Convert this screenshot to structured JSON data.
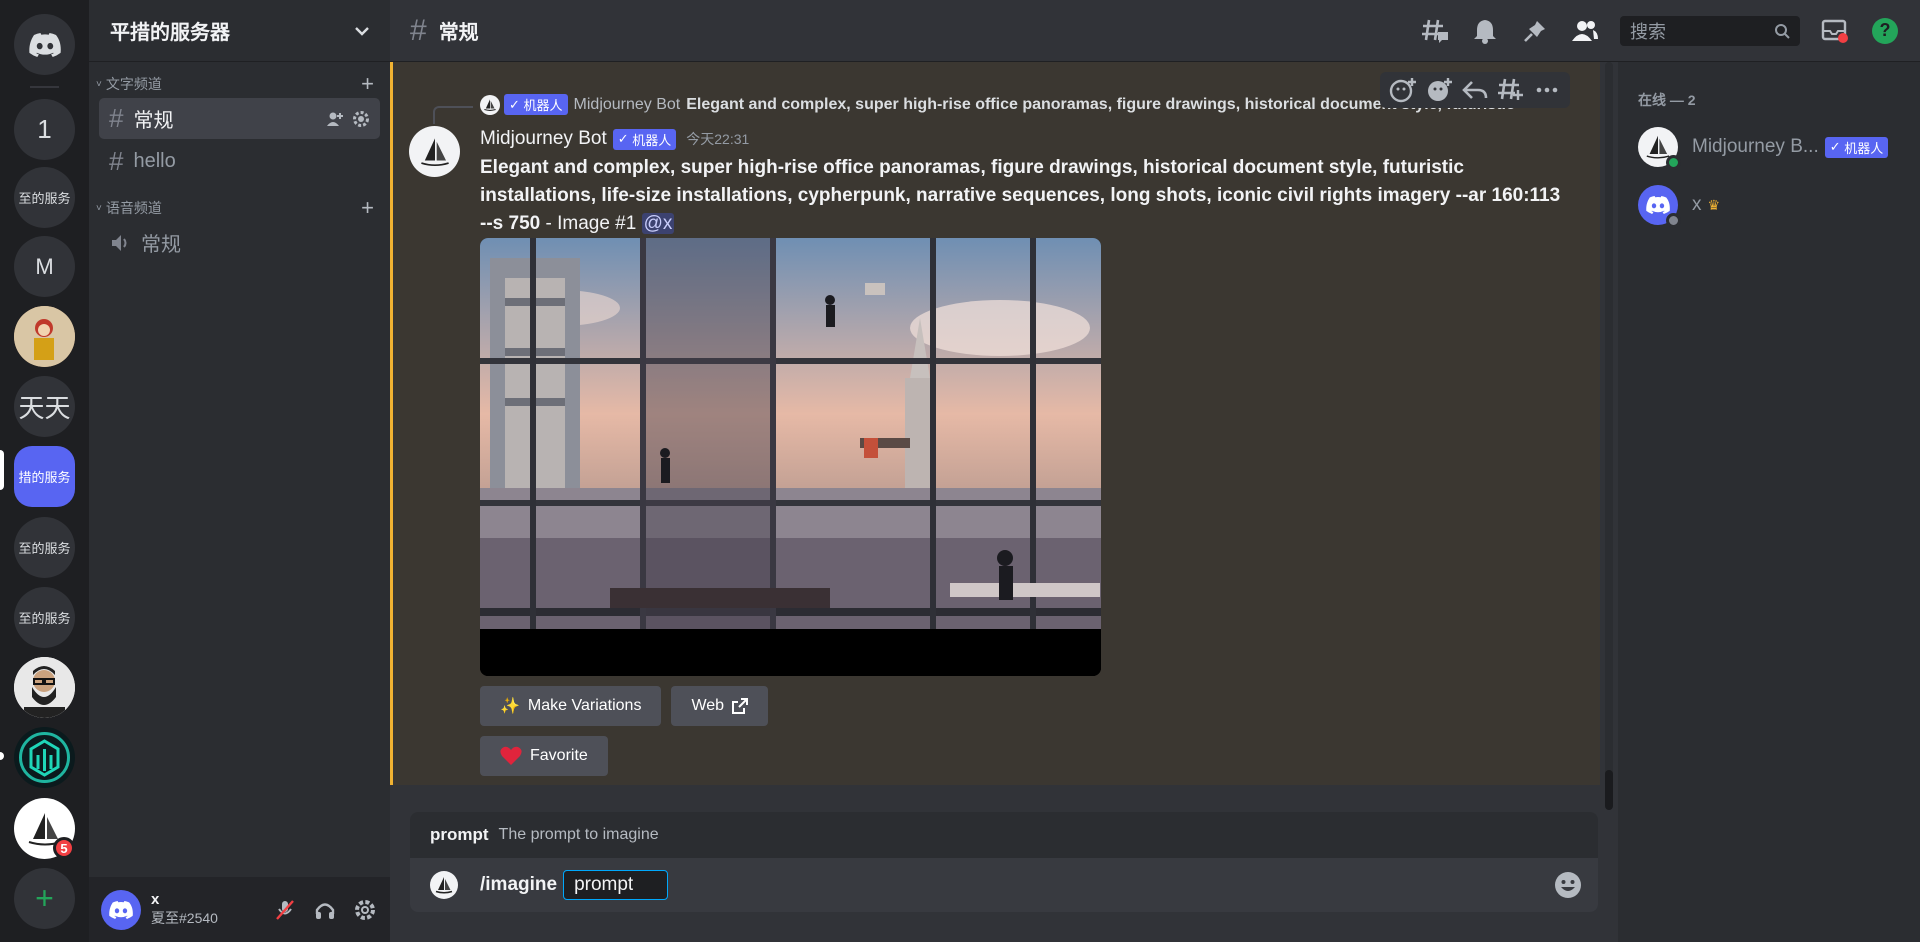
{
  "rail": {
    "servers": [
      {
        "label": "1"
      },
      {
        "label": "至的服务"
      },
      {
        "label": "M"
      },
      {
        "label": ""
      },
      {
        "label": "天天"
      },
      {
        "label": "措的服务"
      },
      {
        "label": "至的服务"
      },
      {
        "label": "至的服务"
      },
      {
        "label": ""
      },
      {
        "label": ""
      },
      {
        "label": "",
        "badge": "5"
      }
    ]
  },
  "server": {
    "name": "平措的服务器"
  },
  "categories": {
    "text": {
      "label": "文字频道"
    },
    "voice": {
      "label": "语音频道"
    }
  },
  "channels": {
    "text": [
      {
        "name": "常规"
      },
      {
        "name": "hello"
      }
    ],
    "voice": [
      {
        "name": "常规"
      }
    ]
  },
  "user": {
    "name": "x",
    "tag": "夏至#2540"
  },
  "topbar": {
    "channel": "常规",
    "search_placeholder": "搜索"
  },
  "message": {
    "reply_author": "Midjourney Bot",
    "reply_text": "Elegant and complex, super high-rise office panoramas, figure drawings, historical document style, futuristic",
    "bot_badge": "机器人",
    "author": "Midjourney Bot",
    "time": "今天22:31",
    "prompt_text": "Elegant and complex, super high-rise office panoramas, figure drawings, historical document style, futuristic installations, life-size installations, cypherpunk, narrative sequences, long shots, iconic civil rights imagery --ar 160:113 --s 750",
    "suffix": " - Image #1 ",
    "mention": "@x",
    "buttons": {
      "variations": "Make Variations",
      "web": "Web",
      "favorite": "Favorite"
    }
  },
  "prompt": {
    "hint_key": "prompt",
    "hint_desc": "The prompt to imagine",
    "command": "/imagine",
    "option": "prompt"
  },
  "members": {
    "header": "在线 — 2",
    "list": [
      {
        "name": "Midjourney B...",
        "badge": "机器人"
      },
      {
        "name": "x"
      }
    ]
  },
  "colors": {
    "accent": "#5865f2",
    "online": "#23a55a",
    "highlight": "#f0b232",
    "danger": "#f23f43"
  }
}
